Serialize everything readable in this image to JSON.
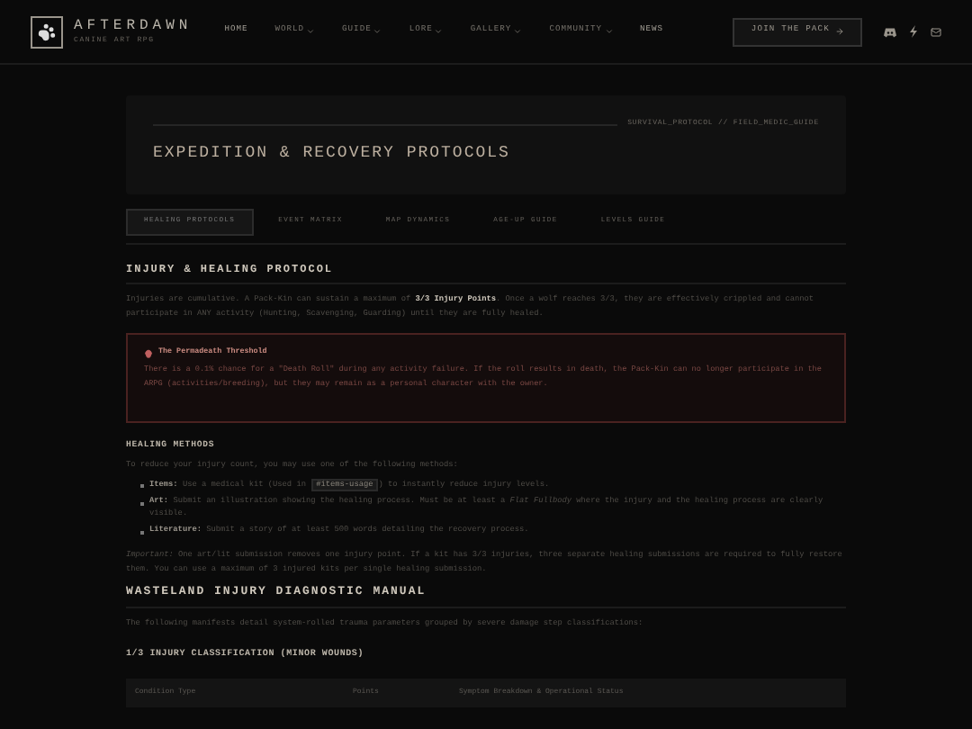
{
  "brand": {
    "name": "AFTERDAWN",
    "tagline": "CANINE ART RPG"
  },
  "nav": [
    {
      "label": "HOME",
      "dropdown": false
    },
    {
      "label": "WORLD",
      "dropdown": true
    },
    {
      "label": "GUIDE",
      "dropdown": true
    },
    {
      "label": "LORE",
      "dropdown": true
    },
    {
      "label": "GALLERY",
      "dropdown": true
    },
    {
      "label": "COMMUNITY",
      "dropdown": true
    },
    {
      "label": "NEWS",
      "dropdown": false
    }
  ],
  "join_button": "JOIN THE PACK",
  "header": {
    "breadcrumb": "SURVIVAL_PROTOCOL // FIELD_MEDIC_GUIDE",
    "title": "EXPEDITION & RECOVERY PROTOCOLS"
  },
  "tabs": [
    {
      "label": "HEALING PROTOCOLS",
      "selected": true
    },
    {
      "label": "EVENT MATRIX",
      "selected": false
    },
    {
      "label": "MAP DYNAMICS",
      "selected": false
    },
    {
      "label": "AGE-UP GUIDE",
      "selected": false
    },
    {
      "label": "LEVELS GUIDE",
      "selected": false
    }
  ],
  "section": {
    "heading": "INJURY & HEALING PROTOCOL",
    "intro": "Injuries are cumulative. A Pack-Kin can sustain a maximum of **3/3 Injury Points**. Once a wolf reaches 3/3, they are effectively crippled and cannot participate in ANY activity (Hunting, Scavenging, Guarding) until they are fully healed."
  },
  "warning": {
    "title": "The Permadeath Threshold",
    "text": "There is a 0.1% chance for a \"Death Roll\" during any activity failure. If the roll results in death, the Pack-Kin can no longer participate in the ARPG (activities/breeding), but they may remain as a personal character with the owner."
  },
  "methods": {
    "heading": "HEALING METHODS",
    "intro": "To reduce your injury count, you may use one of the following methods:",
    "items": [
      {
        "label": "Items:",
        "before": "Use a medical kit (Used in",
        "code": "#items-usage",
        "after": ") to instantly reduce injury levels."
      },
      {
        "label": "Art:",
        "text": "Submit an illustration showing the healing process. Must be at least a *Flat Fullbody* where the injury and the healing process are clearly visible."
      },
      {
        "label": "Literature:",
        "text": "Submit a story of at least 500 words detailing the recovery process."
      }
    ],
    "note": "*Important:* One art/lit submission removes one injury point. If a kit has 3/3 injuries, three separate healing submissions are required to fully restore them. You can use a maximum of 3 injured kits per single healing submission."
  },
  "manual": {
    "heading": "WASTELAND INJURY DIAGNOSTIC MANUAL",
    "intro": "The following manifests detail system-rolled trauma parameters grouped by severe damage step classifications:",
    "subheading": "1/3 INJURY CLASSIFICATION (MINOR WOUNDS)",
    "columns": [
      "Condition Type",
      "Points",
      "Symptom Breakdown & Operational Status"
    ]
  }
}
